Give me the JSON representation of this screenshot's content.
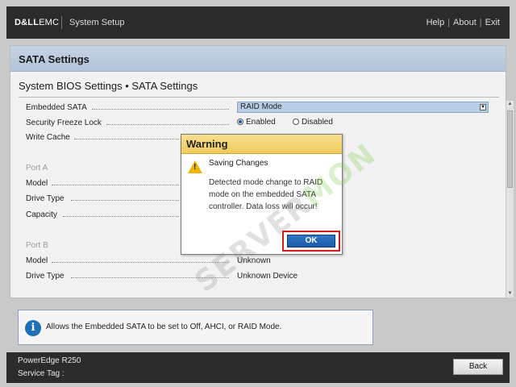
{
  "topbar": {
    "logo_bold": "D&LL",
    "logo_light": "EMC",
    "app_title": "System Setup",
    "nav": [
      "Help",
      "About",
      "Exit"
    ]
  },
  "panel": {
    "title": "SATA Settings",
    "subtitle": "System BIOS Settings • SATA Settings"
  },
  "settings": {
    "embedded_sata": {
      "label": "Embedded SATA",
      "value": "RAID Mode"
    },
    "security_freeze_lock": {
      "label": "Security Freeze Lock",
      "options": [
        "Enabled",
        "Disabled"
      ],
      "selected": "Enabled"
    },
    "write_cache": {
      "label": "Write Cache"
    },
    "port_a": {
      "label": "Port A"
    },
    "model_a": {
      "label": "Model"
    },
    "drive_type_a": {
      "label": "Drive Type"
    },
    "capacity_a": {
      "label": "Capacity"
    },
    "port_b": {
      "label": "Port B"
    },
    "model_b": {
      "label": "Model",
      "value": "Unknown"
    },
    "drive_type_b": {
      "label": "Drive Type",
      "value": "Unknown Device"
    }
  },
  "help": {
    "text": "Allows the Embedded SATA to be set to Off, AHCI, or RAID Mode."
  },
  "footer": {
    "model": "PowerEdge R250",
    "service_tag": "Service Tag :",
    "back_label": "Back"
  },
  "dialog": {
    "title": "Warning",
    "heading": "Saving Changes",
    "message": "Detected mode change to RAID mode on the embedded SATA controller. Data loss will occur!",
    "ok_label": "OK"
  },
  "watermark": {
    "text_gray": "SERVER",
    "text_green": "MON"
  },
  "colors": {
    "header_bar": "#2b2b2b",
    "panel_header": "#b3c5da",
    "dialog_header": "#efcc5c",
    "ok_button": "#1a5aa6",
    "highlight_frame": "#d41b1b"
  }
}
